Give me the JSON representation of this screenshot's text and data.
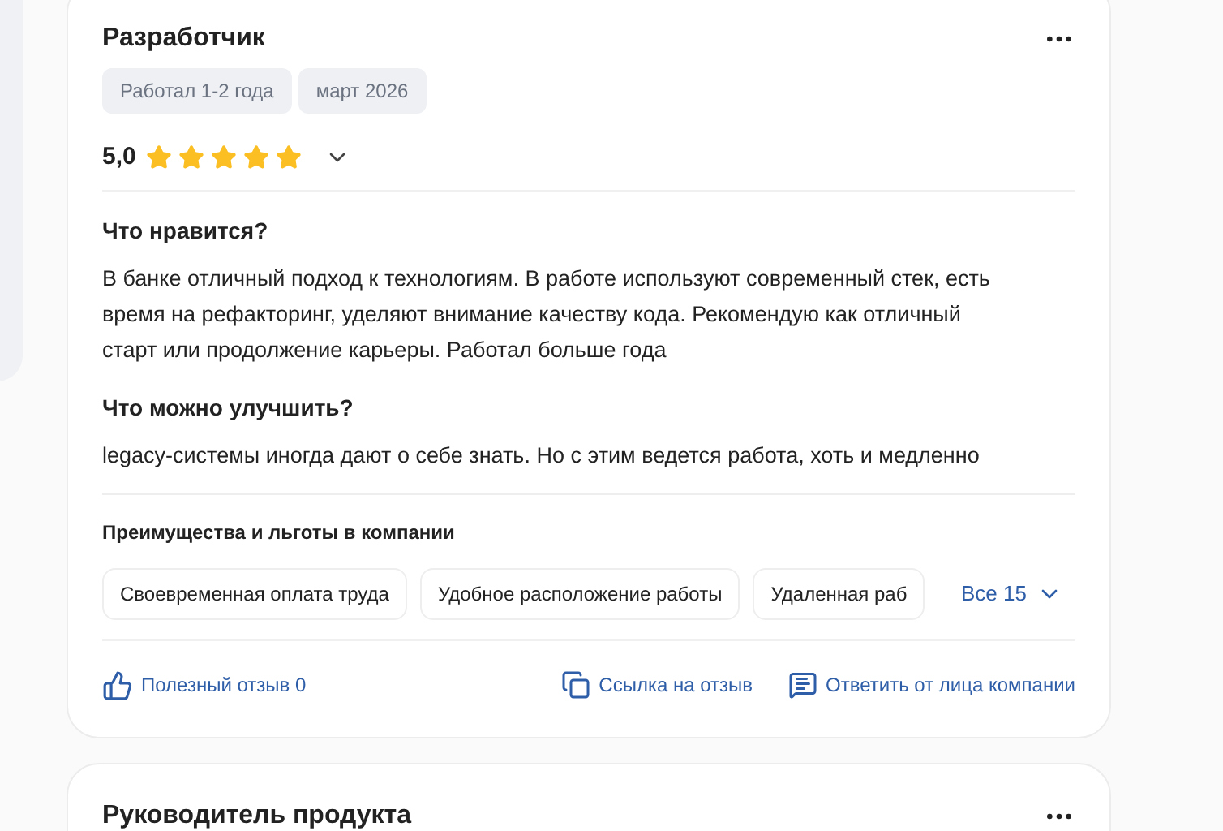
{
  "review": {
    "title": "Разработчик",
    "tags": [
      "Работал 1-2 года",
      "март 2026"
    ],
    "rating": "5,0",
    "stars": 5,
    "sections": [
      {
        "heading": "Что нравится?",
        "text": "В банке отличный подход к технологиям. В работе используют современный стек, есть время на рефакторинг, уделяют внимание качеству кода. Рекомендую как отличный старт или продолжение карьеры. Работал больше года"
      },
      {
        "heading": "Что можно улучшить?",
        "text": "legacy-системы иногда дают о себе знать. Но с этим ведется работа, хоть и медленно"
      }
    ],
    "benefits": {
      "heading": "Преимущества и льготы в компании",
      "items": [
        "Своевременная оплата труда",
        "Удобное расположение работы",
        "Удаленная раб"
      ],
      "more": "Все 15"
    },
    "actions": {
      "useful": "Полезный отзыв 0",
      "link": "Ссылка на отзыв",
      "reply": "Ответить от лица компании"
    }
  },
  "next_review": {
    "title": "Руководитель продукта"
  }
}
